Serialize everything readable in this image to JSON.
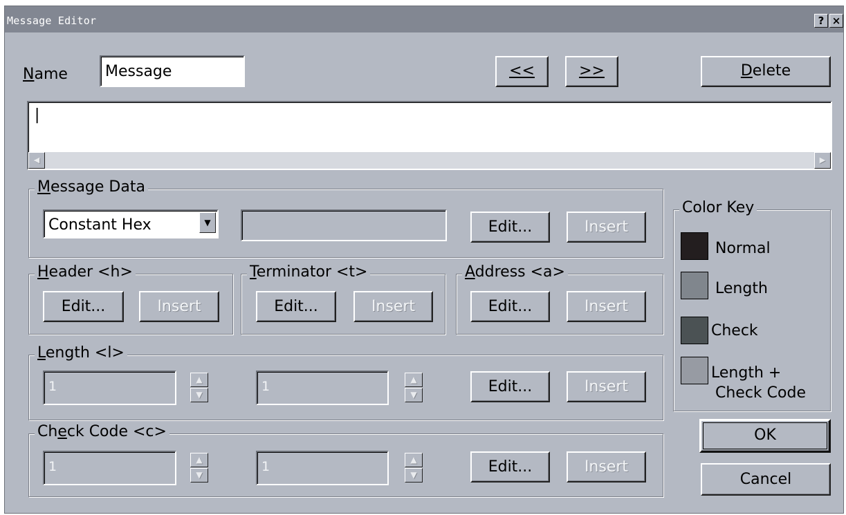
{
  "window": {
    "title": "Message Editor",
    "help_label": "?",
    "close_label": "×"
  },
  "name_row": {
    "label": "Name",
    "value": "Message",
    "prev_label": "<<",
    "next_label": ">>",
    "delete_label": "Delete"
  },
  "message_text": {
    "value": "|"
  },
  "message_data": {
    "legend": "Message Data",
    "type_selected": "Constant Hex",
    "value": "",
    "edit_label": "Edit...",
    "insert_label": "Insert"
  },
  "header": {
    "legend": "Header <h>",
    "edit_label": "Edit...",
    "insert_label": "Insert"
  },
  "terminator": {
    "legend": "Terminator <t>",
    "edit_label": "Edit...",
    "insert_label": "Insert"
  },
  "address": {
    "legend": "Address <a>",
    "edit_label": "Edit...",
    "insert_label": "Insert"
  },
  "length": {
    "legend": "Length <l>",
    "value1": "1",
    "value2": "1",
    "edit_label": "Edit...",
    "insert_label": "Insert"
  },
  "check_code": {
    "legend": "Check Code <c>",
    "value1": "1",
    "value2": "1",
    "edit_label": "Edit...",
    "insert_label": "Insert"
  },
  "color_key": {
    "legend": "Color Key",
    "items": [
      {
        "label": "Normal",
        "color": "#231e1f"
      },
      {
        "label": "Length",
        "color": "#80868d"
      },
      {
        "label": "Check",
        "color": "#4b5254"
      },
      {
        "label": "Length +",
        "label2": "Check Code",
        "color": "#979ba3"
      }
    ]
  },
  "footer": {
    "ok_label": "OK",
    "cancel_label": "Cancel"
  },
  "colors": {
    "face": "#b4b9c3",
    "titlebar": "#828792"
  }
}
